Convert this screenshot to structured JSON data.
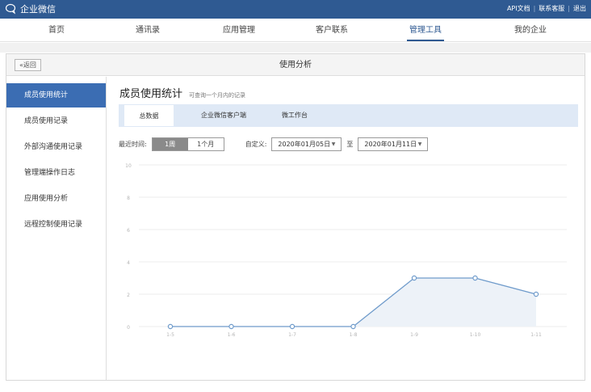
{
  "app": {
    "name": "企业微信"
  },
  "top_links": [
    "API文档",
    "联系客服",
    "退出"
  ],
  "nav": [
    {
      "label": "首页",
      "active": false
    },
    {
      "label": "通讯录",
      "active": false
    },
    {
      "label": "应用管理",
      "active": false
    },
    {
      "label": "客户联系",
      "active": false
    },
    {
      "label": "管理工具",
      "active": true
    },
    {
      "label": "我的企业",
      "active": false
    }
  ],
  "panel": {
    "back_label": "«返回",
    "title": "使用分析"
  },
  "sidebar": {
    "items": [
      {
        "label": "成员使用统计",
        "active": true
      },
      {
        "label": "成员使用记录",
        "active": false
      },
      {
        "label": "外部沟通使用记录",
        "active": false
      },
      {
        "label": "管理端操作日志",
        "active": false
      },
      {
        "label": "应用使用分析",
        "active": false
      },
      {
        "label": "远程控制使用记录",
        "active": false
      }
    ]
  },
  "content": {
    "title": "成员使用统计",
    "subtitle": "可查询一个月内的记录",
    "tabs": [
      {
        "label": "总数据",
        "active": true
      },
      {
        "label": "企业微信客户端",
        "active": false
      },
      {
        "label": "微工作台",
        "active": false
      }
    ],
    "filter": {
      "recent_label": "最近时间:",
      "options": [
        {
          "label": "1周",
          "selected": true
        },
        {
          "label": "1个月",
          "selected": false
        }
      ],
      "custom_label": "自定义:",
      "start_date": "2020年01月05日",
      "to_label": "至",
      "end_date": "2020年01月11日",
      "caret": "▼"
    }
  },
  "colors": {
    "brand": "#2f5a92",
    "sidebar_active": "#3b6db3",
    "series": "#6f9bcb",
    "area": "#edf2f8"
  },
  "chart_data": {
    "type": "area",
    "categories": [
      "1-5",
      "1-6",
      "1-7",
      "1-8",
      "1-9",
      "1-10",
      "1-11"
    ],
    "values": [
      0,
      0,
      0,
      0,
      3,
      3,
      2
    ],
    "ylim": [
      0,
      10
    ],
    "yticks": [
      0,
      2,
      4,
      6,
      8,
      10
    ],
    "grid": true
  }
}
